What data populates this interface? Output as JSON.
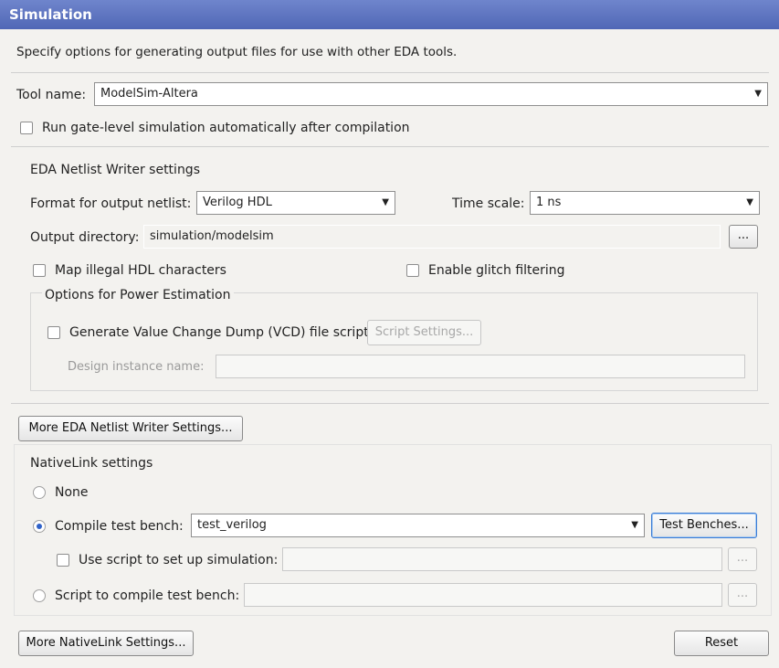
{
  "title": "Simulation",
  "description": "Specify options for generating output files for use with other EDA tools.",
  "tool": {
    "label": "Tool name:",
    "value": "ModelSim-Altera"
  },
  "run_gate_level": {
    "label": "Run gate-level simulation automatically after compilation",
    "checked": false
  },
  "netlist": {
    "group_title": "EDA Netlist Writer settings",
    "format_label": "Format for output netlist:",
    "format_value": "Verilog HDL",
    "timescale_label": "Time scale:",
    "timescale_value": "1 ns",
    "output_dir_label": "Output directory:",
    "output_dir_value": "simulation/modelsim",
    "browse_label": "...",
    "map_illegal_label": "Map illegal HDL characters",
    "glitch_label": "Enable glitch filtering"
  },
  "power": {
    "group_title": "Options for Power Estimation",
    "vcd_label": "Generate Value Change Dump (VCD) file script",
    "script_settings_label": "Script Settings...",
    "design_instance_label": "Design instance name:",
    "design_instance_value": ""
  },
  "more_netlist_button": "More EDA Netlist Writer Settings...",
  "nativelink": {
    "group_title": "NativeLink settings",
    "none_label": "None",
    "compile_tb_label": "Compile test bench:",
    "compile_tb_value": "test_verilog",
    "test_benches_button": "Test Benches...",
    "use_script_label": "Use script to set up simulation:",
    "use_script_value": "",
    "script_compile_label": "Script to compile test bench:",
    "script_compile_value": "",
    "browse_label": "..."
  },
  "more_nativelink_button": "More NativeLink Settings...",
  "reset_button": "Reset"
}
